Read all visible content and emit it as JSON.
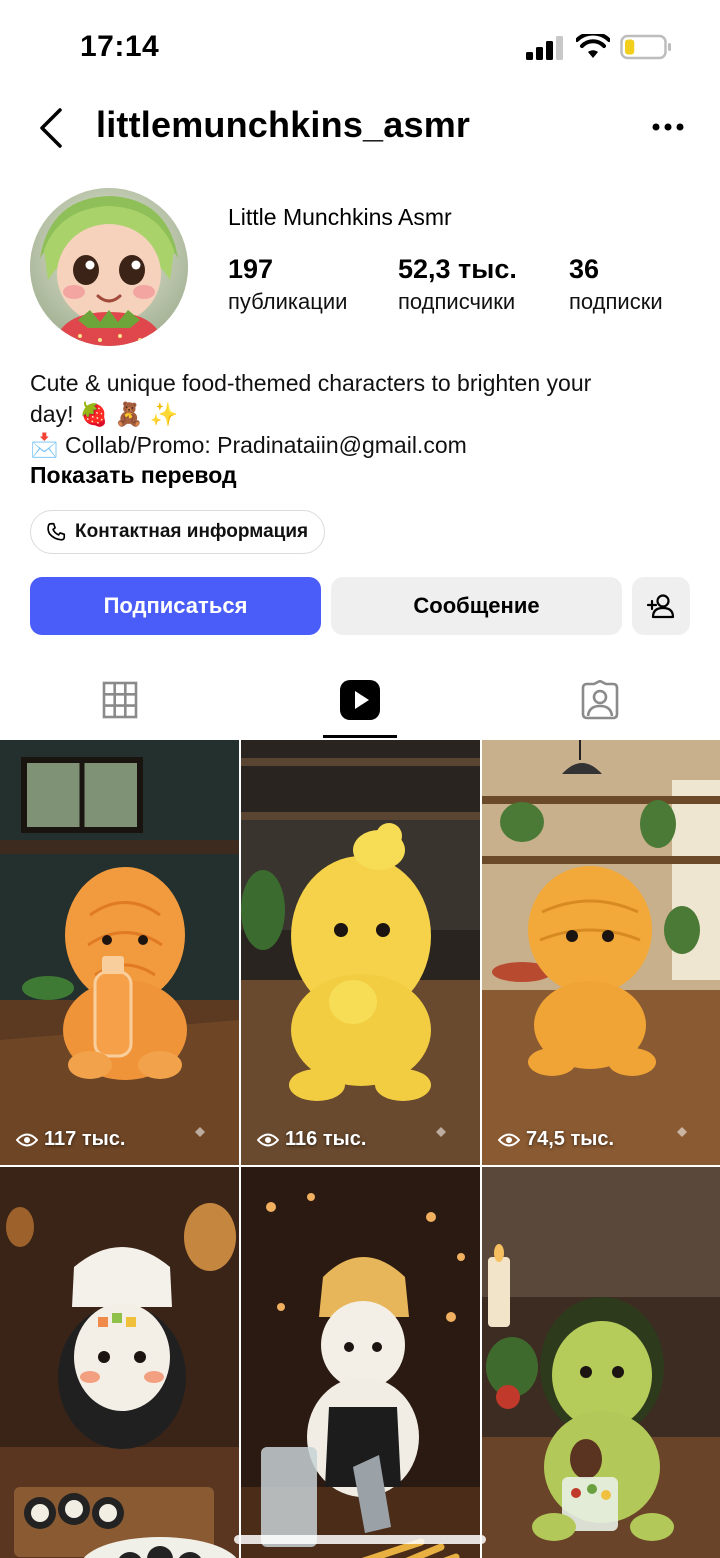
{
  "status_bar": {
    "time": "17:14",
    "battery_level": 0.25
  },
  "header": {
    "handle": "littlemunchkins_asmr"
  },
  "profile": {
    "display_name": "Little Munchkins Asmr",
    "stats": [
      {
        "value": "197",
        "label": "публикации"
      },
      {
        "value": "52,3 тыс.",
        "label": "подписчики"
      },
      {
        "value": "36",
        "label": "подписки"
      }
    ],
    "bio_lines": [
      "Cute & unique food-themed characters to brighten your",
      "day! 🍓 🧸 ✨",
      "📩 Collab/Promo: Pradinataiin@gmail.com"
    ],
    "translate_label": "Показать перевод",
    "contact_label": "Контактная информация"
  },
  "actions": {
    "follow_label": "Подписаться",
    "message_label": "Сообщение"
  },
  "tabs": [
    "grid",
    "reels",
    "tagged"
  ],
  "active_tab": "reels",
  "reels": [
    {
      "views": "117 тыс.",
      "theme": "orange-tangerine"
    },
    {
      "views": "116 тыс.",
      "theme": "yellow-chick"
    },
    {
      "views": "74,5 тыс.",
      "theme": "cheese"
    },
    {
      "views": "",
      "theme": "sushi"
    },
    {
      "views": "",
      "theme": "rice-bar"
    },
    {
      "views": "",
      "theme": "avocado"
    }
  ],
  "colors": {
    "accent": "#4a5df9",
    "secondary_button": "#efefef"
  }
}
